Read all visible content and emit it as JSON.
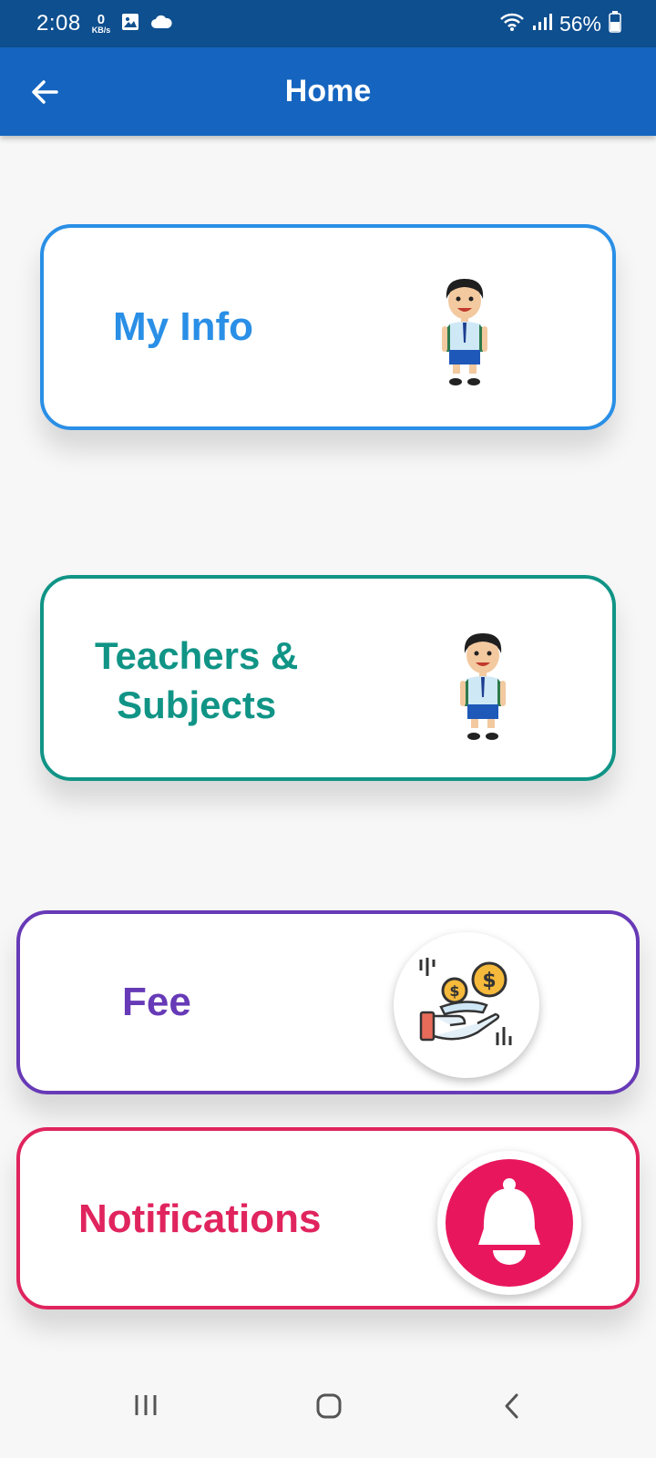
{
  "status_bar": {
    "time": "2:08",
    "net_speed_value": "0",
    "net_speed_unit": "KB/s",
    "battery": "56%"
  },
  "app_bar": {
    "title": "Home"
  },
  "cards": {
    "my_info": "My Info",
    "teachers_line1": "Teachers &",
    "teachers_line2": "Subjects",
    "fee": "Fee",
    "notifications": "Notifications"
  },
  "colors": {
    "status_bar": "#0e4f8f",
    "app_bar": "#1565c0",
    "my_info": "#2a8fe6",
    "teachers": "#109486",
    "fee": "#673ab7",
    "notifications": "#e0245e"
  },
  "icons": [
    "back-arrow-icon",
    "student-icon",
    "money-hand-icon",
    "bell-icon",
    "recent-apps-icon",
    "home-icon",
    "back-icon"
  ]
}
